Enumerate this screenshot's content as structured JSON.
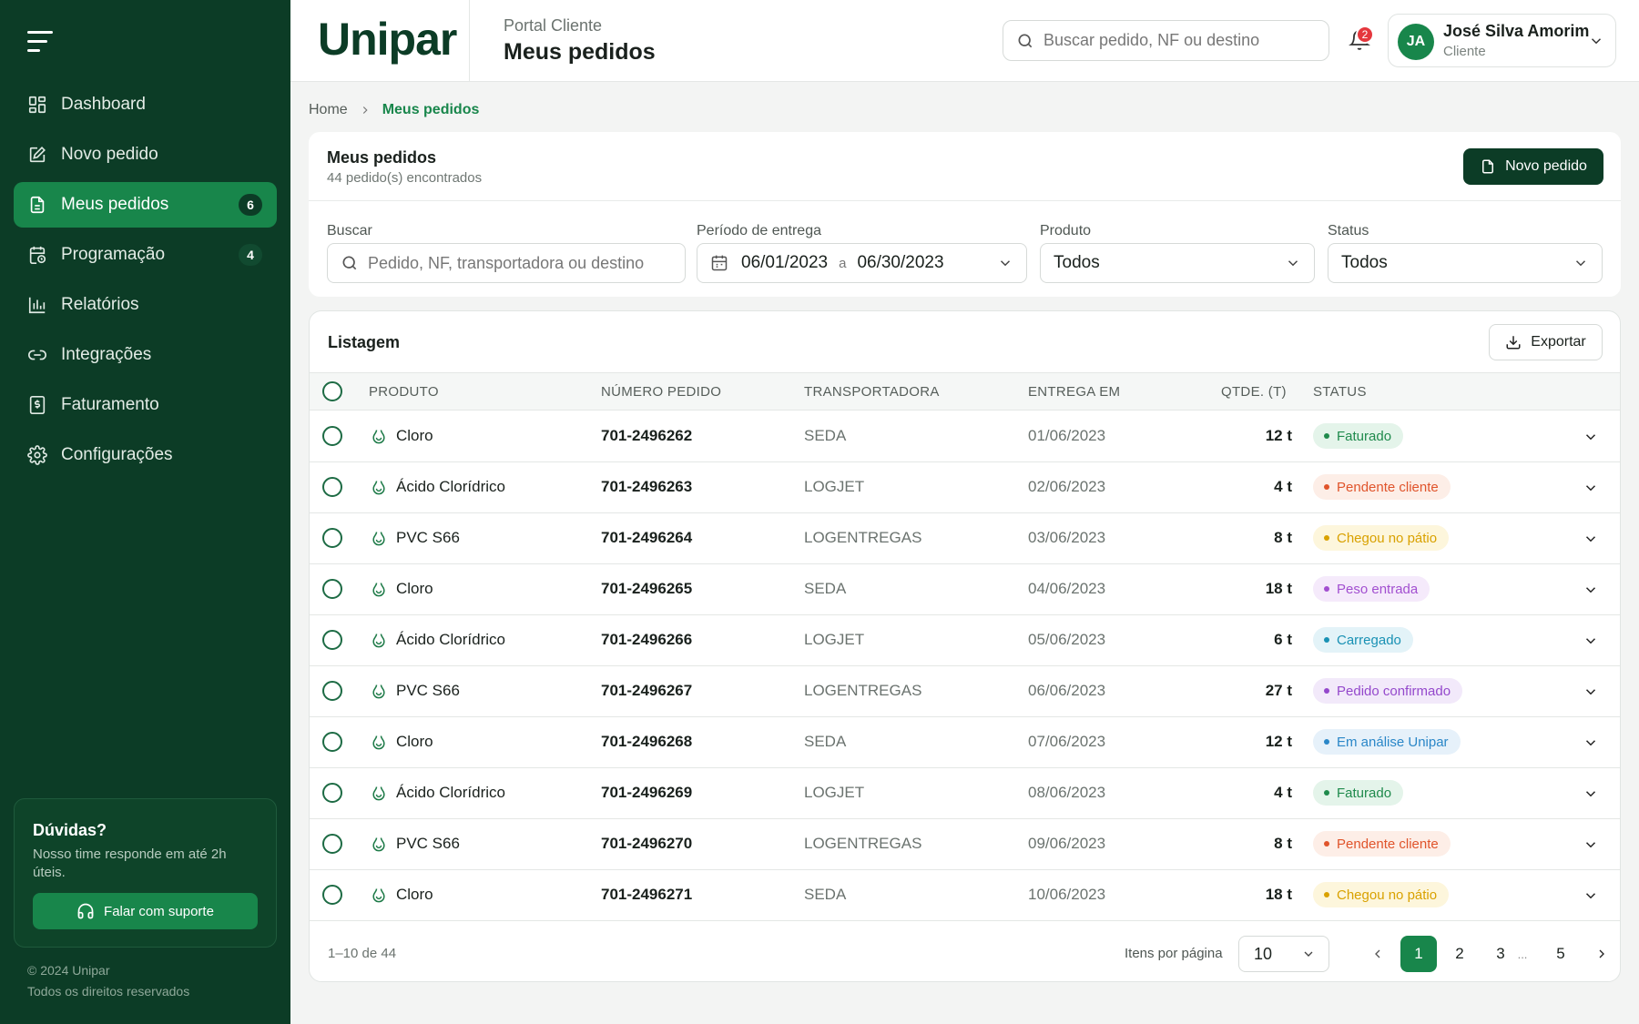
{
  "sidebar": {
    "items": [
      {
        "label": "Dashboard",
        "icon": "grid-icon"
      },
      {
        "label": "Novo pedido",
        "icon": "edit-icon"
      },
      {
        "label": "Meus pedidos",
        "icon": "document-icon",
        "badge": "6",
        "active": true
      },
      {
        "label": "Programação",
        "icon": "calendar-clock-icon",
        "badge": "4"
      },
      {
        "label": "Relatórios",
        "icon": "bar-chart-icon"
      },
      {
        "label": "Integrações",
        "icon": "link-icon"
      },
      {
        "label": "Faturamento",
        "icon": "receipt-icon"
      },
      {
        "label": "Configurações",
        "icon": "gear-icon"
      }
    ],
    "help": {
      "title": "Dúvidas?",
      "text": "Nosso time responde em até 2h úteis.",
      "button": "Falar com suporte"
    },
    "copyright": "© 2024 Unipar",
    "rights": "Todos os direitos reservados"
  },
  "header": {
    "logo": "Unipar",
    "portal": "Portal Cliente",
    "title": "Meus pedidos",
    "search_placeholder": "Buscar pedido, NF ou destino",
    "notifications": "2",
    "user": {
      "initials": "JA",
      "name": "José Silva Amorim",
      "role": "Cliente"
    }
  },
  "breadcrumb": {
    "home": "Home",
    "current": "Meus pedidos"
  },
  "filters": {
    "title": "Meus pedidos",
    "subtitle": "44 pedido(s) encontrados",
    "new_button": "Novo pedido",
    "search_label": "Buscar",
    "search_placeholder": "Pedido, NF, transportadora ou destino",
    "period_label": "Período de entrega",
    "date_from": "06/01/2023",
    "date_sep": "a",
    "date_to": "06/30/2023",
    "product_label": "Produto",
    "product_value": "Todos",
    "status_label": "Status",
    "status_value": "Todos"
  },
  "table": {
    "title": "Listagem",
    "export_button": "Exportar",
    "columns": {
      "product": "PRODUTO",
      "number": "NÚMERO PEDIDO",
      "carrier": "TRANSPORTADORA",
      "delivery": "ENTREGA EM",
      "qty": "QTDE. (T)",
      "status": "STATUS"
    },
    "rows": [
      {
        "product": "Cloro",
        "number": "701-2496262",
        "carrier": "SEDA",
        "delivery": "01/06/2023",
        "qty": "12 t",
        "status": "Faturado",
        "status_color": "#1f8a4c",
        "status_bg": "#e4f4ea"
      },
      {
        "product": "Ácido Clorídrico",
        "number": "701-2496263",
        "carrier": "LOGJET",
        "delivery": "02/06/2023",
        "qty": "4 t",
        "status": "Pendente cliente",
        "status_color": "#e0542b",
        "status_bg": "#fdeee7"
      },
      {
        "product": "PVC S66",
        "number": "701-2496264",
        "carrier": "LOGENTREGAS",
        "delivery": "03/06/2023",
        "qty": "8 t",
        "status": "Chegou no pátio",
        "status_color": "#d9a100",
        "status_bg": "#fdf6dc"
      },
      {
        "product": "Cloro",
        "number": "701-2496265",
        "carrier": "SEDA",
        "delivery": "04/06/2023",
        "qty": "18 t",
        "status": "Peso entrada",
        "status_color": "#a24fd0",
        "status_bg": "#f5eafb"
      },
      {
        "product": "Ácido Clorídrico",
        "number": "701-2496266",
        "carrier": "LOGJET",
        "delivery": "05/06/2023",
        "qty": "6 t",
        "status": "Carregado",
        "status_color": "#1991b4",
        "status_bg": "#e3f3f8"
      },
      {
        "product": "PVC S66",
        "number": "701-2496267",
        "carrier": "LOGENTREGAS",
        "delivery": "06/06/2023",
        "qty": "27 t",
        "status": "Pedido confirmado",
        "status_color": "#9448cc",
        "status_bg": "#f2e9fa"
      },
      {
        "product": "Cloro",
        "number": "701-2496268",
        "carrier": "SEDA",
        "delivery": "07/06/2023",
        "qty": "12 t",
        "status": "Em análise Unipar",
        "status_color": "#2a87c8",
        "status_bg": "#e6f1fa"
      },
      {
        "product": "Ácido Clorídrico",
        "number": "701-2496269",
        "carrier": "LOGJET",
        "delivery": "08/06/2023",
        "qty": "4 t",
        "status": "Faturado",
        "status_color": "#1f8a4c",
        "status_bg": "#e4f4ea"
      },
      {
        "product": "PVC S66",
        "number": "701-2496270",
        "carrier": "LOGENTREGAS",
        "delivery": "09/06/2023",
        "qty": "8 t",
        "status": "Pendente cliente",
        "status_color": "#e0542b",
        "status_bg": "#fdeee7"
      },
      {
        "product": "Cloro",
        "number": "701-2496271",
        "carrier": "SEDA",
        "delivery": "10/06/2023",
        "qty": "18 t",
        "status": "Chegou no pátio",
        "status_color": "#d9a100",
        "status_bg": "#fdf6dc"
      }
    ]
  },
  "pagination": {
    "range": "1–10 de 44",
    "per_page_label": "Itens por página",
    "per_page": "10",
    "pages": [
      "1",
      "2",
      "3",
      "...",
      "5"
    ],
    "current": "1"
  }
}
